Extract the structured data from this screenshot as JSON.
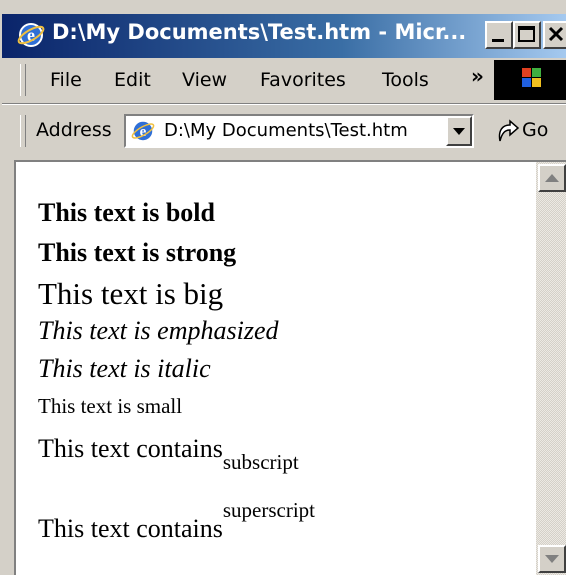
{
  "window": {
    "title": "D:\\My Documents\\Test.htm - Micr...",
    "title_color": "#0a246a"
  },
  "menu": {
    "items": [
      "File",
      "Edit",
      "View",
      "Favorites",
      "Tools"
    ],
    "overflow": "»"
  },
  "address": {
    "label": "Address",
    "value": "D:\\My Documents\\Test.htm",
    "go_label": "Go"
  },
  "document": {
    "bold": "This text is bold",
    "strong": "This text is strong",
    "big": "This text is big",
    "emphasized": "This text is emphasized",
    "italic": "This text is italic",
    "small": "This text is small",
    "sub_prefix": "This text contains",
    "sub_text": "subscript",
    "sup_prefix": "This text contains",
    "sup_text": "superscript"
  }
}
